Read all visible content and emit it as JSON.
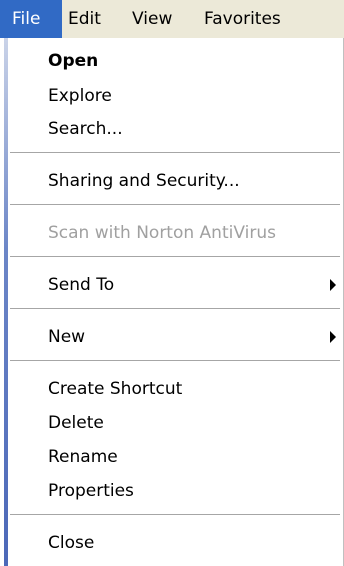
{
  "menubar": {
    "items": [
      {
        "label": "File",
        "active": true
      },
      {
        "label": "Edit",
        "active": false
      },
      {
        "label": "View",
        "active": false
      },
      {
        "label": "Favorites",
        "active": false
      }
    ]
  },
  "menu": {
    "items": [
      {
        "label": "Open",
        "bold": true,
        "disabled": false,
        "submenu": false
      },
      {
        "label": "Explore",
        "bold": false,
        "disabled": false,
        "submenu": false
      },
      {
        "label": "Search...",
        "bold": false,
        "disabled": false,
        "submenu": false
      },
      {
        "label": "Sharing and Security...",
        "bold": false,
        "disabled": false,
        "submenu": false
      },
      {
        "label": "Scan with Norton AntiVirus",
        "bold": false,
        "disabled": true,
        "submenu": false
      },
      {
        "label": "Send To",
        "bold": false,
        "disabled": false,
        "submenu": true
      },
      {
        "label": "New",
        "bold": false,
        "disabled": false,
        "submenu": true
      },
      {
        "label": "Create Shortcut",
        "bold": false,
        "disabled": false,
        "submenu": false
      },
      {
        "label": "Delete",
        "bold": false,
        "disabled": false,
        "submenu": false
      },
      {
        "label": "Rename",
        "bold": false,
        "disabled": false,
        "submenu": false
      },
      {
        "label": "Properties",
        "bold": false,
        "disabled": false,
        "submenu": false
      },
      {
        "label": "Close",
        "bold": false,
        "disabled": false,
        "submenu": false
      }
    ]
  },
  "colors": {
    "highlight": "#316ac5",
    "menubar_bg": "#ece9d8",
    "disabled_text": "#a0a0a0"
  }
}
